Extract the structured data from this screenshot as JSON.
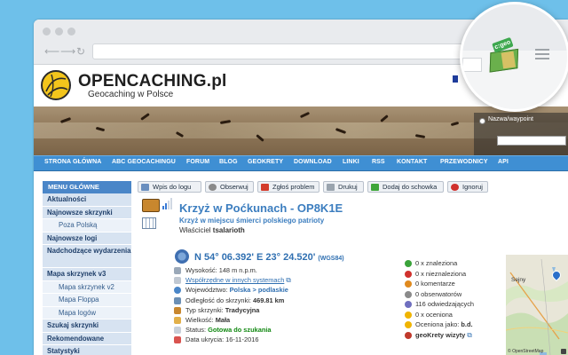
{
  "site": {
    "title": "OPENCACHING.pl",
    "subtitle": "Geocaching w Polsce"
  },
  "search": {
    "radio_label": "Nazwa/waypoint"
  },
  "menu": [
    "STRONA GŁÓWNA",
    "ABC GEOCACHINGU",
    "FORUM",
    "BLOG",
    "GEOKRETY",
    "DOWNLOAD",
    "LINKI",
    "RSS",
    "KONTAKT",
    "PRZEWODNICY",
    "API"
  ],
  "sidebar": {
    "header": "MENU GŁÓWNE",
    "items": [
      "Aktualności",
      "Najnowsze skrzynki",
      "Poza Polską",
      "Najnowsze logi",
      "Nadchodzące wydarzenia",
      "Mapa skrzynek v3",
      "Mapa skrzynek v2",
      "Mapa Floppa",
      "Mapa logów",
      "Szukaj skrzynki",
      "Rekomendowane",
      "Statystyki"
    ]
  },
  "toolbar": {
    "log": "Wpis do logu",
    "watch": "Obserwuj",
    "report": "Zgłoś problem",
    "print": "Drukuj",
    "add_clipboard": "Dodaj do schowka",
    "ignore": "Ignoruj"
  },
  "cache": {
    "title": "Krzyż w Poćkunach - OP8K1E",
    "description": "Krzyż w miejscu śmierci polskiego patrioty",
    "owner_label": "Właściciel",
    "owner_name": "tsalarioth",
    "coords": "N 54° 06.392' E 23° 24.520'",
    "datum": "(WGS84)"
  },
  "info": {
    "altitude": "Wysokość: 148 m n.p.m.",
    "other_systems": "Współrzędne w innych systemach",
    "voivodeship_label": "Województwo:",
    "voivodeship_value": "Polska > podlaskie",
    "distance_label": "Odległość do skrzynki:",
    "distance_value": "469.81 km",
    "type_label": "Typ skrzynki:",
    "type_value": "Tradycyjna",
    "size_label": "Wielkość:",
    "size_value": "Mała",
    "status_label": "Status:",
    "status_value": "Gotowa do szukania",
    "created": "Data ukrycia: 16-11-2016"
  },
  "stats": {
    "found": "0 x znaleziona",
    "not_found": "0 x nieznaleziona",
    "comments": "0 komentarze",
    "watchers": "0 obserwatorów",
    "visits": "116 odwiedzających",
    "rated": "0 x oceniona",
    "rating_label": "Oceniona jako:",
    "rating_value": "b.d.",
    "geokrety": "geoKrety wizyty"
  },
  "map": {
    "town": "Sejny",
    "attribution": "© OpenStreetMap"
  },
  "extension": {
    "badge": "c:geo"
  },
  "colors": {
    "accent": "#3f8fd3",
    "link": "#2f6fb1",
    "background": "#6ec0ea"
  }
}
